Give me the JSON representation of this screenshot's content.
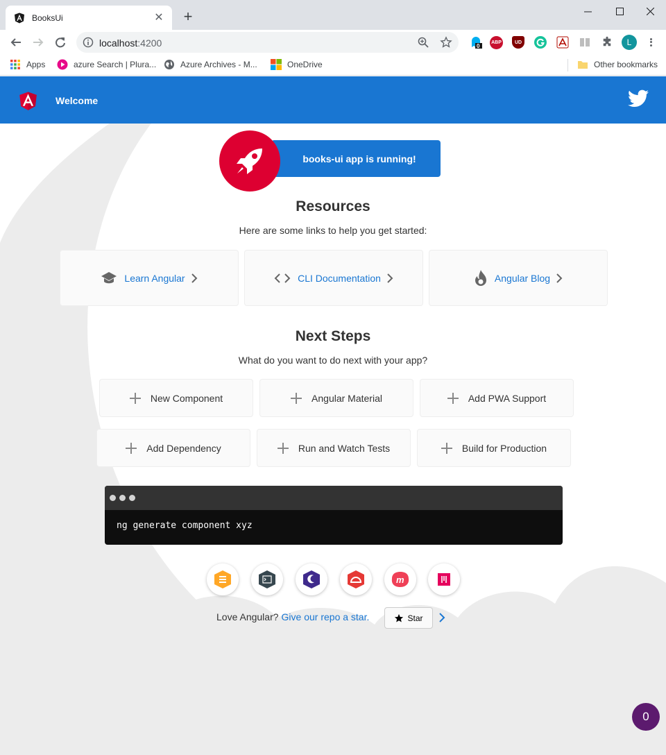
{
  "browser": {
    "tab_title": "BooksUi",
    "url_host": "localhost",
    "url_port": ":4200",
    "extension_badge": "0",
    "abp_label": "ABP",
    "ublock_label": "UD",
    "avatar_initial": "L",
    "bookmarks": [
      {
        "label": "Apps",
        "icon": "apps-grid-icon"
      },
      {
        "label": "azure Search | Plura...",
        "icon": "pluralsight-icon"
      },
      {
        "label": "Azure Archives - M...",
        "icon": "globe-icon"
      },
      {
        "label": "OneDrive",
        "icon": "microsoft-icon"
      }
    ],
    "other_bookmarks": "Other bookmarks"
  },
  "app": {
    "header_title": "Welcome",
    "running_text": "books-ui app is running!",
    "resources_title": "Resources",
    "resources_subtitle": "Here are some links to help you get started:",
    "resources": [
      {
        "label": "Learn Angular",
        "icon": "graduation-cap-icon"
      },
      {
        "label": "CLI Documentation",
        "icon": "code-brackets-icon"
      },
      {
        "label": "Angular Blog",
        "icon": "flame-icon"
      }
    ],
    "next_title": "Next Steps",
    "next_subtitle": "What do you want to do next with your app?",
    "steps": [
      "New Component",
      "Angular Material",
      "Add PWA Support",
      "Add Dependency",
      "Run and Watch Tests",
      "Build for Production"
    ],
    "terminal_command": "ng generate component xyz",
    "community_links": [
      "animations-icon",
      "cli-icon",
      "augury-icon",
      "protractor-icon",
      "meetup-icon",
      "discord-icon"
    ],
    "love_text": "Love Angular?",
    "love_link": "Give our repo a star.",
    "star_label": "Star",
    "badge_count": "0"
  },
  "colors": {
    "primary": "#1976d2",
    "angular_red": "#dd0031",
    "badge": "#5c1a6e"
  }
}
